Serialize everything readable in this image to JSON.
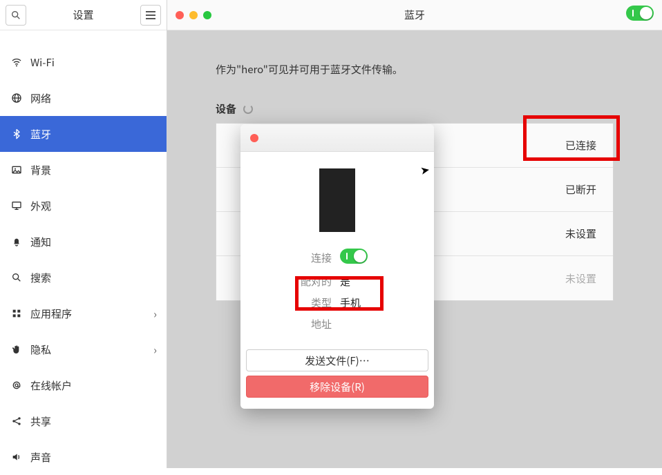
{
  "sidebar": {
    "title": "设置",
    "items": [
      {
        "label": "Wi-Fi",
        "icon": "wifi-icon"
      },
      {
        "label": "网络",
        "icon": "globe-icon"
      },
      {
        "label": "蓝牙",
        "icon": "bluetooth-icon",
        "active": true
      },
      {
        "label": "背景",
        "icon": "image-icon"
      },
      {
        "label": "外观",
        "icon": "monitor-icon"
      },
      {
        "label": "通知",
        "icon": "bell-icon"
      },
      {
        "label": "搜索",
        "icon": "search-icon"
      },
      {
        "label": "应用程序",
        "icon": "grid-icon",
        "chevron": true
      },
      {
        "label": "隐私",
        "icon": "hand-icon",
        "chevron": true
      },
      {
        "label": "在线帐户",
        "icon": "at-icon"
      },
      {
        "label": "共享",
        "icon": "share-icon"
      },
      {
        "label": "声音",
        "icon": "sound-icon"
      }
    ]
  },
  "main": {
    "title": "蓝牙",
    "bluetooth_on": true,
    "visibility_msg": "作为\"hero\"可见并可用于蓝牙文件传输。",
    "devices_label": "设备",
    "device_statuses": [
      "已连接",
      "已断开",
      "未设置",
      "未设置"
    ]
  },
  "dialog": {
    "connection_label": "连接",
    "connected": true,
    "paired_label": "配对的",
    "paired_value": "是",
    "type_label": "类型",
    "type_value": "手机",
    "address_label": "地址",
    "address_value": "",
    "send_file_label": "发送文件(F)…",
    "remove_device_label": "移除设备(R)"
  }
}
